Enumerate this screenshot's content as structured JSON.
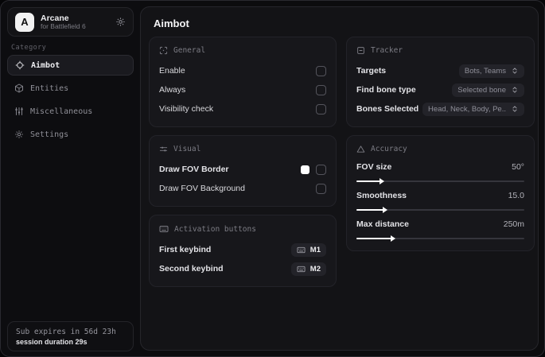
{
  "colors": {
    "swatch_white": "#ffffff",
    "slider_fill": "#ffffff"
  },
  "sidebar": {
    "brand": {
      "logo_letter": "A",
      "name": "Arcane",
      "subtitle": "for Battlefield 6"
    },
    "category_label": "Category",
    "items": [
      {
        "label": "Aimbot",
        "icon": "crosshair-icon",
        "active": true
      },
      {
        "label": "Entities",
        "icon": "cube-icon",
        "active": false
      },
      {
        "label": "Miscellaneous",
        "icon": "sliders-icon",
        "active": false
      },
      {
        "label": "Settings",
        "icon": "gear-icon",
        "active": false
      }
    ],
    "footer": {
      "line1": "Sub expires in 56d 23h",
      "line2": "session duration 29s"
    }
  },
  "main": {
    "title": "Aimbot",
    "cards": {
      "general": {
        "title": "General",
        "icon": "scan-icon",
        "rows": [
          {
            "label": "Enable",
            "control": "checkbox",
            "checked": false
          },
          {
            "label": "Always",
            "control": "checkbox",
            "checked": false
          },
          {
            "label": "Visibility check",
            "control": "checkbox",
            "checked": false
          }
        ]
      },
      "visual": {
        "title": "Visual",
        "icon": "tune-icon",
        "rows": [
          {
            "label": "Draw FOV Border",
            "control": "checkbox",
            "checked": false,
            "swatch_color": "#ffffff"
          },
          {
            "label": "Draw FOV Background",
            "control": "checkbox",
            "checked": false
          }
        ]
      },
      "activation": {
        "title": "Activation buttons",
        "icon": "keyboard-icon",
        "rows": [
          {
            "label": "First keybind",
            "key": "M1"
          },
          {
            "label": "Second keybind",
            "key": "M2"
          }
        ]
      },
      "tracker": {
        "title": "Tracker",
        "icon": "frame-minus-icon",
        "rows": [
          {
            "label": "Targets",
            "value": "Bots, Teams"
          },
          {
            "label": "Find bone type",
            "value": "Selected bone"
          },
          {
            "label": "Bones Selected",
            "value": "Head, Neck, Body, Pe.."
          }
        ]
      },
      "accuracy": {
        "title": "Accuracy",
        "icon": "triangle-icon",
        "sliders": [
          {
            "label": "FOV size",
            "value": "50°",
            "fill_percent": 14
          },
          {
            "label": "Smoothness",
            "value": "15.0",
            "fill_percent": 16
          },
          {
            "label": "Max distance",
            "value": "250m",
            "fill_percent": 21
          }
        ]
      }
    }
  }
}
